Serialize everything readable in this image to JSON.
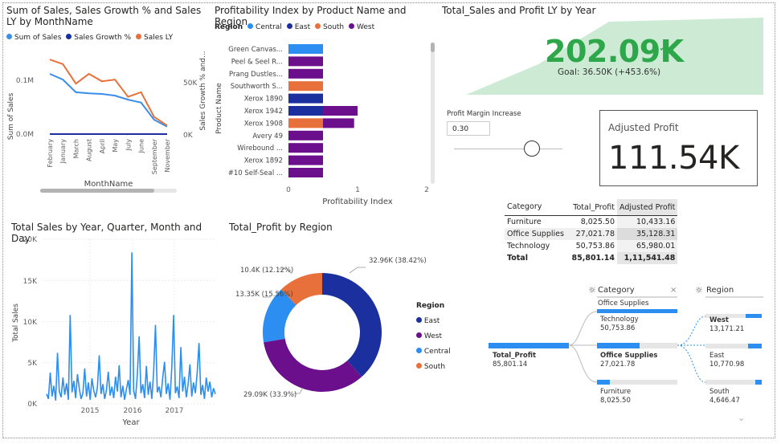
{
  "v1": {
    "title": "Sum of Sales, Sales Growth % and Sales LY by MonthName",
    "legend": [
      {
        "label": "Sum of Sales",
        "color": "#3b8ee8"
      },
      {
        "label": "Sales Growth %",
        "color": "#1b2f9e"
      },
      {
        "label": "Sales LY",
        "color": "#e8703b"
      }
    ],
    "y_left_label": "Sum of Sales",
    "y_right_label": "Sales Growth % and...",
    "y_left_ticks": [
      "0.1M",
      "0.0M"
    ],
    "y_right_ticks": [
      "50K",
      "0K"
    ],
    "x_label": "MonthName"
  },
  "v2": {
    "title": "Profitability Index by Product Name and Region",
    "legend_title": "Region",
    "legend": [
      {
        "label": "Central",
        "color": "#2b8ef0"
      },
      {
        "label": "East",
        "color": "#1b2f9e"
      },
      {
        "label": "South",
        "color": "#e8703b"
      },
      {
        "label": "West",
        "color": "#6b0f8c"
      }
    ],
    "y_label": "Product Name",
    "x_label": "Profitability Index",
    "x_ticks": [
      "0",
      "1",
      "2"
    ]
  },
  "v3": {
    "title": "Total_Sales and Profit LY by Year",
    "kpi_value": "202.09K",
    "kpi_goal": "Goal: 36.50K (+453.6%)",
    "check_icon": "check-icon"
  },
  "slicer": {
    "label": "Profit Margin Increase",
    "value": "0.30",
    "level": 0.55
  },
  "card": {
    "label": "Adjusted Profit",
    "value": "111.54K"
  },
  "table": {
    "headers": [
      "Category",
      "Total_Profit",
      "Adjusted Profit"
    ],
    "rows": [
      [
        "Furniture",
        "8,025.50",
        "10,433.16"
      ],
      [
        "Office Supplies",
        "27,021.78",
        "35,128.31"
      ],
      [
        "Technology",
        "50,753.86",
        "65,980.01"
      ]
    ],
    "total": [
      "Total",
      "85,801.14",
      "1,11,541.48"
    ]
  },
  "v4": {
    "title": "Total Sales by Year, Quarter, Month and Day",
    "y_label": "Total Sales",
    "x_label": "Year",
    "y_ticks": [
      "20K",
      "15K",
      "10K",
      "5K",
      "0K"
    ],
    "x_ticks": [
      "2015",
      "2016",
      "2017"
    ]
  },
  "v5": {
    "title": "Total_Profit by Region",
    "legend_title": "Region",
    "labels": [
      "32.96K (38.42%)",
      "29.09K (33.9%)",
      "13.35K (15.56%)",
      "10.4K (12.12%)"
    ],
    "legend": [
      "East",
      "West",
      "Central",
      "South"
    ]
  },
  "tree": {
    "header_category": "Category",
    "header_region": "Region",
    "root_label": "Total_Profit",
    "root_value": "85,801.14",
    "filter_label": "Office Supplies",
    "cat_nodes": [
      {
        "label": "Technology",
        "value": "50,753.86"
      },
      {
        "label": "Office Supplies",
        "value": "27,021.78"
      },
      {
        "label": "Furniture",
        "value": "8,025.50"
      }
    ],
    "region_nodes": [
      {
        "label": "West",
        "value": "13,171.21"
      },
      {
        "label": "East",
        "value": "10,770.98"
      },
      {
        "label": "South",
        "value": "4,646.47"
      }
    ]
  },
  "chart_data": [
    {
      "type": "line",
      "title": "Sum of Sales, Sales Growth % and Sales LY by MonthName",
      "xlabel": "MonthName",
      "ylabel": "Sum of Sales",
      "categories": [
        "February",
        "January",
        "March",
        "August",
        "April",
        "May",
        "July",
        "June",
        "September",
        "November"
      ],
      "series": [
        {
          "name": "Sum of Sales",
          "values": [
            0.105,
            0.095,
            0.073,
            0.071,
            0.07,
            0.067,
            0.06,
            0.055,
            0.025,
            0.013
          ]
        },
        {
          "name": "Sales Growth %",
          "values": [
            0,
            0,
            0,
            0,
            0,
            0,
            0,
            0,
            0,
            0
          ]
        },
        {
          "name": "Sales LY",
          "values": [
            0.13,
            0.122,
            0.088,
            0.105,
            0.092,
            0.095,
            0.065,
            0.073,
            0.03,
            0.015
          ]
        }
      ],
      "ylim": [
        0,
        0.14
      ]
    },
    {
      "type": "bar",
      "title": "Profitability Index by Product Name and Region",
      "xlabel": "Profitability Index",
      "ylabel": "Product Name",
      "categories": [
        "Green Canvas...",
        "Peel & Seel R...",
        "Prang Dustles...",
        "Southworth S...",
        "Xerox 1890",
        "Xerox 1942",
        "Xerox 1908",
        "Avery 49",
        "Wirebound ...",
        "Xerox 1892",
        "#10 Self-Seal ..."
      ],
      "series": [
        {
          "name": "Central",
          "values": [
            0.5,
            0,
            0,
            0,
            0,
            0,
            0,
            0,
            0,
            0,
            0
          ]
        },
        {
          "name": "East",
          "values": [
            0,
            0,
            0,
            0,
            0.5,
            0.5,
            0,
            0,
            0,
            0,
            0
          ]
        },
        {
          "name": "South",
          "values": [
            0,
            0,
            0,
            0.5,
            0,
            0,
            0.5,
            0,
            0,
            0,
            0
          ]
        },
        {
          "name": "West",
          "values": [
            0,
            0.5,
            0.5,
            0,
            0,
            0.5,
            0.45,
            0.5,
            0.5,
            0.5,
            0.5
          ]
        }
      ],
      "xlim": [
        0,
        2
      ]
    },
    {
      "type": "line",
      "title": "Total Sales by Year, Quarter, Month and Day",
      "xlabel": "Year",
      "ylabel": "Total Sales",
      "x_ticks": [
        "2015",
        "2016",
        "2017"
      ],
      "ylim": [
        0,
        20000
      ],
      "series": [
        {
          "name": "Total Sales",
          "values": [
            1200,
            600,
            3800,
            900,
            2200,
            400,
            6200,
            1500,
            800,
            3200,
            1100,
            2500,
            500,
            10800,
            1400,
            2800,
            700,
            3600,
            1900,
            600,
            1300,
            4300,
            900,
            2600,
            500,
            3100,
            1600,
            800,
            2000,
            5900,
            1200,
            2400,
            600,
            1700,
            3900,
            1000,
            2100,
            700,
            3300,
            1500,
            4700,
            800,
            2200,
            500,
            1800,
            2900,
            1100,
            18400,
            1600,
            600,
            3500,
            8200,
            1300,
            2400,
            700,
            4600,
            1100,
            2700,
            600,
            3900,
            9600,
            1400,
            2100,
            800,
            3200,
            5100,
            1200,
            2500,
            500,
            4400,
            10800,
            1300,
            2100,
            700,
            6900,
            1500,
            3300,
            800,
            2400,
            4800,
            900,
            2600,
            1300,
            3800,
            7400,
            1100,
            2300,
            600,
            3200,
            1500,
            2700,
            800,
            1900,
            1200
          ]
        }
      ]
    },
    {
      "type": "pie",
      "title": "Total_Profit by Region",
      "categories": [
        "East",
        "West",
        "Central",
        "South"
      ],
      "values": [
        32.96,
        29.09,
        13.35,
        10.4
      ]
    }
  ]
}
